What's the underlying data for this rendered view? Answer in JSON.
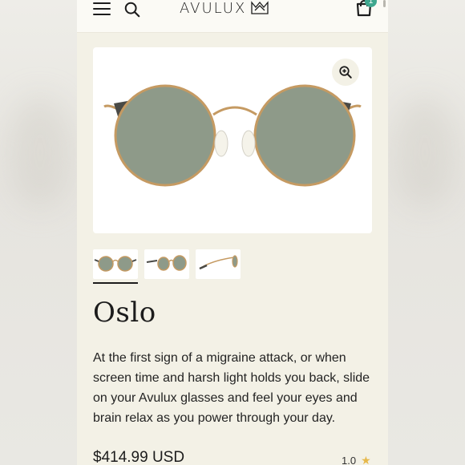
{
  "header": {
    "brand": "AVULUX",
    "cart_count": "1"
  },
  "product": {
    "name": "Oslo",
    "description": "At the first sign of a migraine attack, or when screen time and harsh light holds you back, slide on your Avulux glasses and feel your eyes and brain relax as you power through your day.",
    "price": "$414.99 USD",
    "rating": "1.0"
  },
  "gallery": {
    "thumbnails": [
      "front-view",
      "angled-view",
      "side-view"
    ],
    "active_index": 0
  },
  "colors": {
    "page_bg": "#f3f1e6",
    "header_bg": "#fbfaf5",
    "badge": "#3fa78e",
    "star": "#e6b84a",
    "lens": "#8e9a89",
    "frame": "#c59a62"
  }
}
